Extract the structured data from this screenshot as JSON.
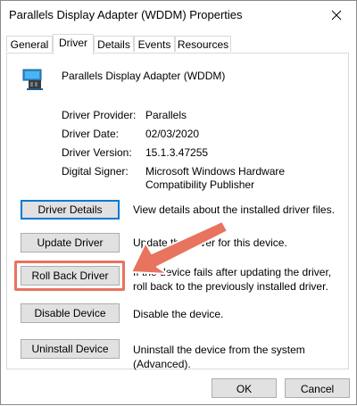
{
  "window": {
    "title": "Parallels Display Adapter (WDDM) Properties",
    "close_icon": "close-icon"
  },
  "tabs": [
    {
      "label": "General",
      "active": false
    },
    {
      "label": "Driver",
      "active": true
    },
    {
      "label": "Details",
      "active": false
    },
    {
      "label": "Events",
      "active": false
    },
    {
      "label": "Resources",
      "active": false
    }
  ],
  "device": {
    "icon": "display-adapter-icon",
    "name": "Parallels Display Adapter (WDDM)"
  },
  "driver_info": {
    "provider_label": "Driver Provider:",
    "provider_value": "Parallels",
    "date_label": "Driver Date:",
    "date_value": "02/03/2020",
    "version_label": "Driver Version:",
    "version_value": "15.1.3.47255",
    "signer_label": "Digital Signer:",
    "signer_value": "Microsoft Windows Hardware Compatibility Publisher"
  },
  "actions": [
    {
      "label": "Driver Details",
      "description": "View details about the installed driver files."
    },
    {
      "label": "Update Driver",
      "description": "Update the driver for this device."
    },
    {
      "label": "Roll Back Driver",
      "description": "If the device fails after updating the driver, roll back to the previously installed driver."
    },
    {
      "label": "Disable Device",
      "description": "Disable the device."
    },
    {
      "label": "Uninstall Device",
      "description": "Uninstall the device from the system (Advanced)."
    }
  ],
  "footer": {
    "ok_label": "OK",
    "cancel_label": "Cancel"
  },
  "colors": {
    "annotation_arrow": "#e8735f",
    "focus_blue": "#0078d7"
  }
}
